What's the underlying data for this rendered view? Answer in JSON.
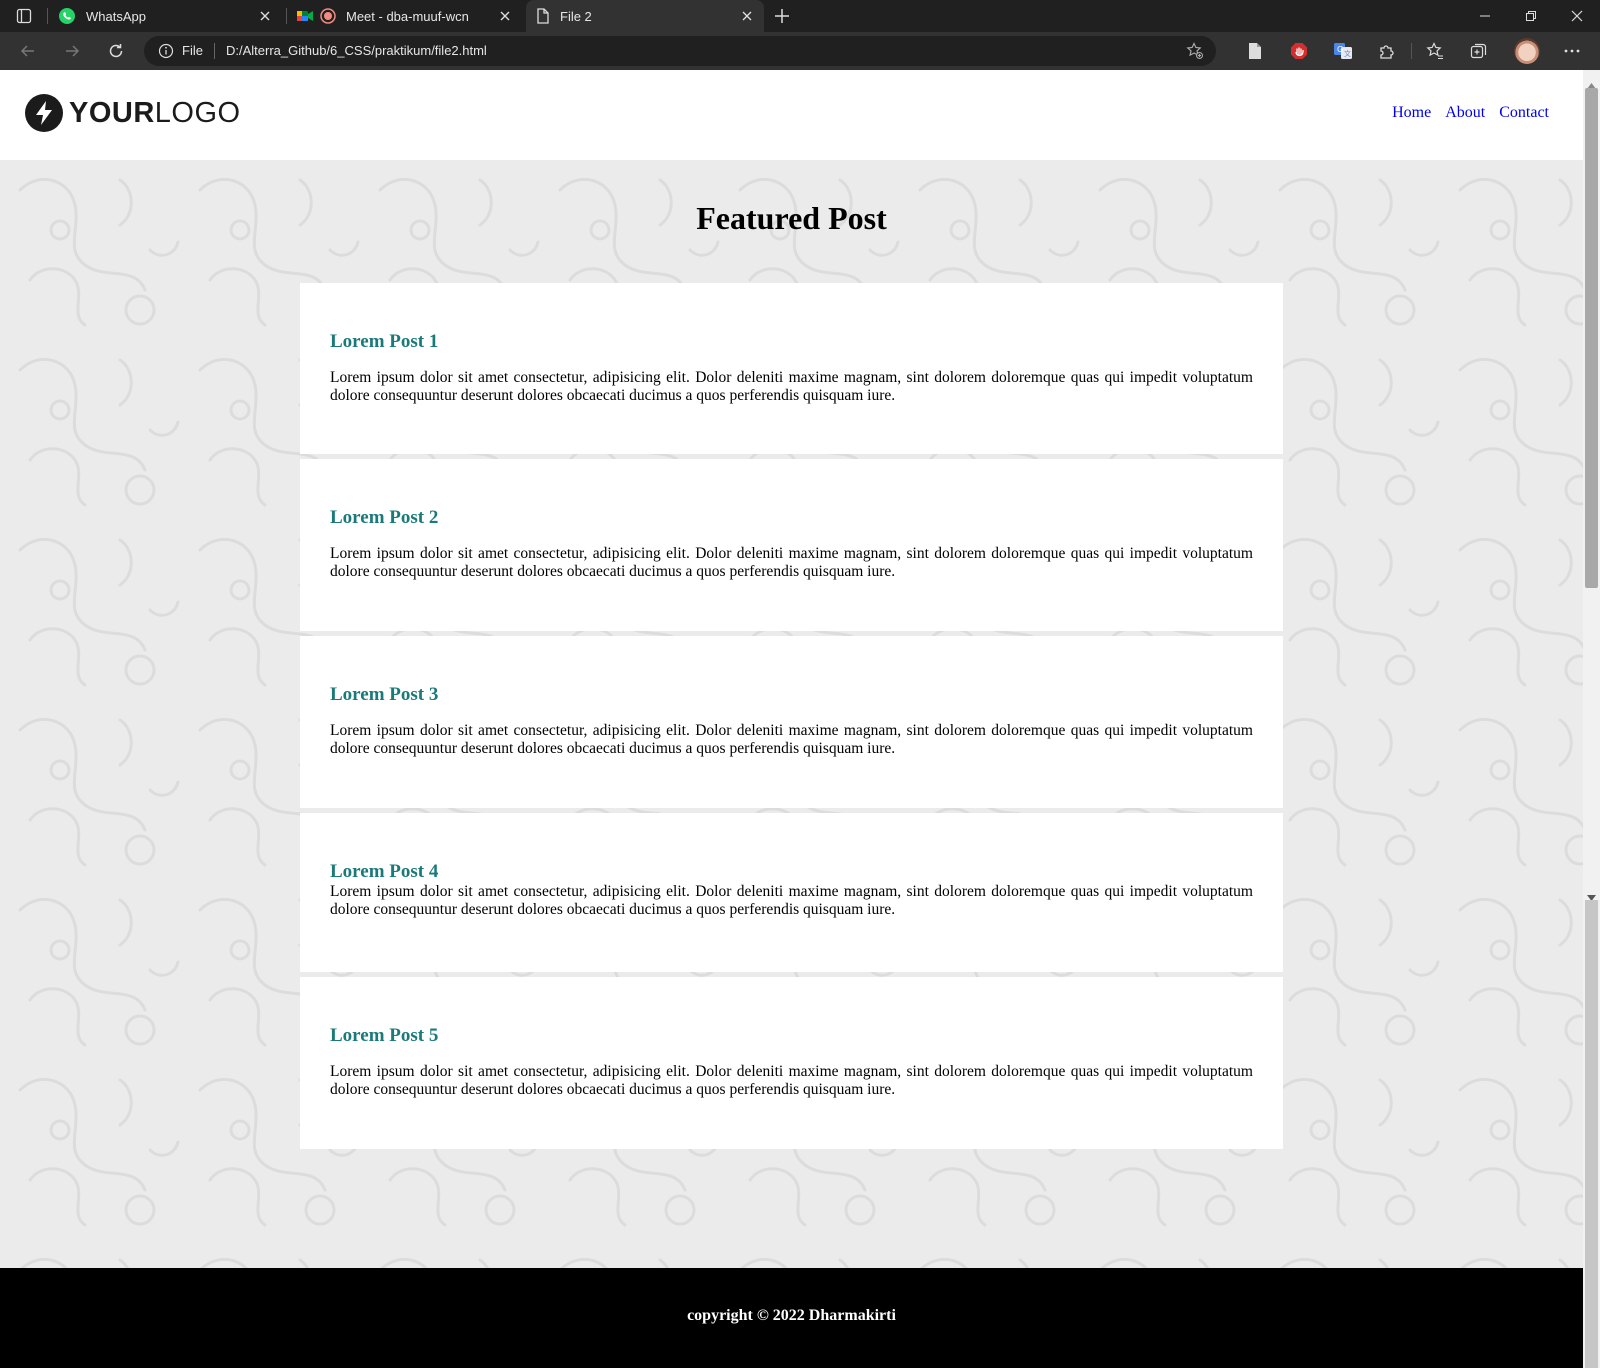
{
  "browser": {
    "tabs": [
      {
        "title": "WhatsApp",
        "icon": "whatsapp-icon"
      },
      {
        "title": "Meet - dba-muuf-wcn",
        "icon": "google-meet-icon"
      },
      {
        "title": "File 2",
        "icon": "file-icon",
        "active": true
      }
    ],
    "address": {
      "scheme_label": "File",
      "url": "D:/Alterra_Github/6_CSS/praktikum/file2.html"
    },
    "colors": {
      "chrome_dark": "#202020",
      "chrome_toolbar": "#323232",
      "tab_text": "#e6e6e6"
    }
  },
  "site": {
    "logo": {
      "bold": "YOUR",
      "regular": "LOGO"
    },
    "nav": [
      "Home",
      "About",
      "Contact"
    ],
    "section_title": "Featured Post",
    "posts": [
      {
        "title": "Lorem Post 1",
        "body": "Lorem ipsum dolor sit amet consectetur, adipisicing elit. Dolor deleniti maxime magnam, sint dolorem doloremque quas qui impedit voluptatum dolore consequuntur deserunt dolores obcaecati ducimus a quos perferendis quisquam iure."
      },
      {
        "title": "Lorem Post 2",
        "body": "Lorem ipsum dolor sit amet consectetur, adipisicing elit. Dolor deleniti maxime magnam, sint dolorem doloremque quas qui impedit voluptatum dolore consequuntur deserunt dolores obcaecati ducimus a quos perferendis quisquam iure."
      },
      {
        "title": "Lorem Post 3",
        "body": "Lorem ipsum dolor sit amet consectetur, adipisicing elit. Dolor deleniti maxime magnam, sint dolorem doloremque quas qui impedit voluptatum dolore consequuntur deserunt dolores obcaecati ducimus a quos perferendis quisquam iure."
      },
      {
        "title": "Lorem Post 4",
        "body": "Lorem ipsum dolor sit amet consectetur, adipisicing elit. Dolor deleniti maxime magnam, sint dolorem doloremque quas qui impedit voluptatum dolore consequuntur deserunt dolores obcaecati ducimus a quos perferendis quisquam iure."
      },
      {
        "title": "Lorem Post 5",
        "body": "Lorem ipsum dolor sit amet consectetur, adipisicing elit. Dolor deleniti maxime magnam, sint dolorem doloremque quas qui impedit voluptatum dolore consequuntur deserunt dolores obcaecati ducimus a quos perferendis quisquam iure."
      }
    ],
    "footer": "copyright © 2022 Dharmakirti",
    "colors": {
      "post_title": "#1a7a7a",
      "nav_link": "#0000ee",
      "page_bg": "#ebebeb",
      "footer_bg": "#000000"
    }
  }
}
